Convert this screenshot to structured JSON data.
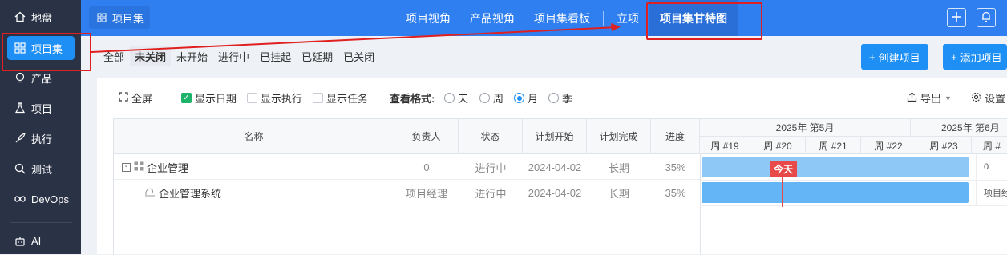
{
  "sidebar": {
    "items": [
      {
        "label": "地盘",
        "icon": "home-icon"
      },
      {
        "label": "项目集",
        "icon": "grid-icon"
      },
      {
        "label": "产品",
        "icon": "lightbulb-icon"
      },
      {
        "label": "项目",
        "icon": "flask-icon"
      },
      {
        "label": "执行",
        "icon": "rocket-icon"
      },
      {
        "label": "测试",
        "icon": "search-icon"
      },
      {
        "label": "DevOps",
        "icon": "infinity-icon"
      },
      {
        "label": "AI",
        "icon": "robot-icon"
      }
    ]
  },
  "topbar": {
    "breadcrumb": "项目集",
    "nav": [
      "项目视角",
      "产品视角",
      "项目集看板",
      "立项",
      "项目集甘特图"
    ]
  },
  "filters": [
    "全部",
    "未关闭",
    "未开始",
    "进行中",
    "已挂起",
    "已延期",
    "已关闭"
  ],
  "actions": {
    "create": "创建项目",
    "add": "添加项目"
  },
  "toolbar": {
    "fullscreen": "全屏",
    "show_date": "显示日期",
    "show_exec": "显示执行",
    "show_task": "显示任务",
    "view_label": "查看格式:",
    "views": [
      "天",
      "周",
      "月",
      "季"
    ],
    "export": "导出",
    "settings": "设置"
  },
  "table": {
    "headers": [
      "名称",
      "负责人",
      "状态",
      "计划开始",
      "计划完成",
      "进度"
    ],
    "months": [
      "2025年 第5月",
      "2025年 第6月"
    ],
    "weeks": [
      "周 #19",
      "周 #20",
      "周 #21",
      "周 #22",
      "周 #23",
      "周 #"
    ],
    "rows": [
      {
        "name": "企业管理",
        "owner": "0",
        "status": "进行中",
        "start": "2024-04-02",
        "end": "长期",
        "progress": "35%",
        "trail": "0"
      },
      {
        "name": "企业管理系统",
        "owner": "项目经理",
        "status": "进行中",
        "start": "2024-04-02",
        "end": "长期",
        "progress": "35%",
        "trail": "项目经"
      }
    ],
    "today": "今天"
  },
  "colors": {
    "primary": "#1e8ff5",
    "topbar": "#2f7ff0",
    "sidebar": "#2a3246",
    "bar": "#64b5f6",
    "today": "#e84a4a"
  }
}
